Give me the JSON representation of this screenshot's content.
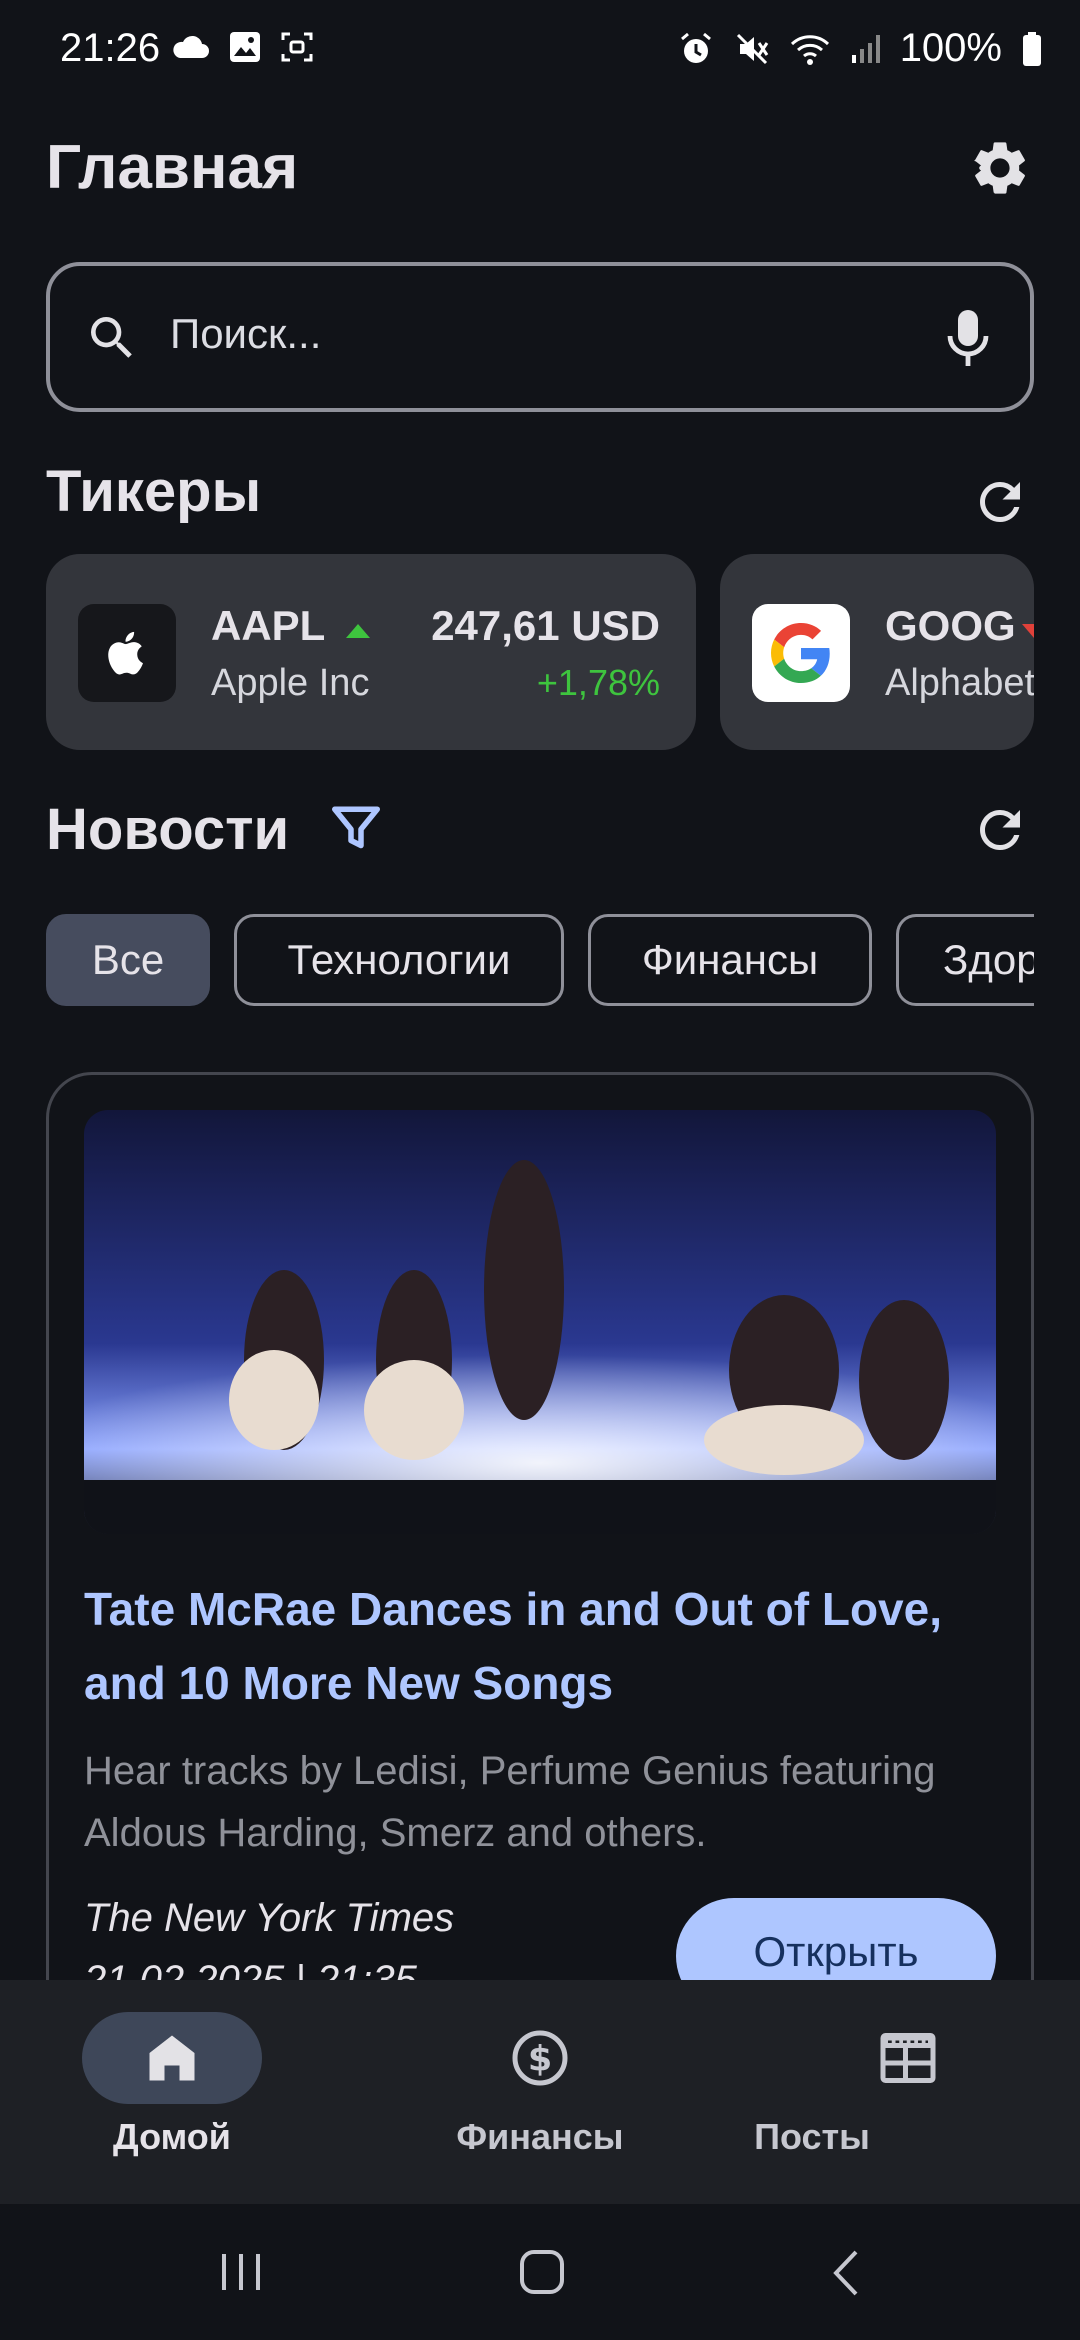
{
  "status_bar": {
    "time": "21:26",
    "battery": "100%"
  },
  "header": {
    "title": "Главная"
  },
  "search": {
    "placeholder": "Поиск..."
  },
  "tickers": {
    "heading": "Тикеры",
    "items": [
      {
        "symbol": "AAPL",
        "name": "Apple Inc",
        "price": "247,61 USD",
        "change": "+1,78%",
        "trend": "up",
        "logo": "apple-logo"
      },
      {
        "symbol": "GOOG",
        "name": "Alphabet",
        "logo": "google-logo"
      }
    ]
  },
  "news": {
    "heading": "Новости",
    "chips": [
      {
        "label": "Все",
        "active": true
      },
      {
        "label": "Технологии",
        "active": false
      },
      {
        "label": "Финансы",
        "active": false
      },
      {
        "label": "Здор",
        "active": false
      }
    ],
    "article": {
      "title": "Tate McRae Dances in and Out of Love, and 10 More New Songs",
      "description": "Hear tracks by Ledisi, Perfume Genius featuring Aldous Harding, Smerz and others.",
      "source": "The New York Times",
      "date": "21.02.2025 | 21:35",
      "open_label": "Открыть"
    }
  },
  "bottom_nav": {
    "items": [
      {
        "label": "Домой",
        "icon": "home-icon",
        "active": true
      },
      {
        "label": "Финансы",
        "icon": "dollar-icon",
        "active": false
      },
      {
        "label": "Посты",
        "icon": "posts-icon",
        "active": false
      }
    ]
  },
  "colors": {
    "background": "#111318",
    "accent": "#aec6ff",
    "positive": "#3ec43e",
    "card": "#33353b"
  }
}
